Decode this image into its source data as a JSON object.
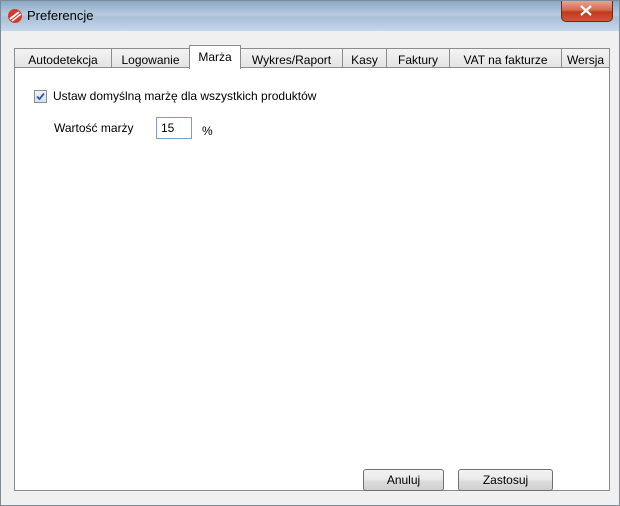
{
  "window": {
    "title": "Preferencje"
  },
  "tabs": [
    {
      "label": "Autodetekcja",
      "active": false
    },
    {
      "label": "Logowanie",
      "active": false
    },
    {
      "label": "Marża",
      "active": true
    },
    {
      "label": "Wykres/Raport",
      "active": false
    },
    {
      "label": "Kasy",
      "active": false
    },
    {
      "label": "Faktury",
      "active": false
    },
    {
      "label": "VAT na fakturze",
      "active": false
    },
    {
      "label": "Wersja",
      "active": false
    }
  ],
  "margin_tab": {
    "default_margin_checkbox": {
      "label": "Ustaw domyślną marżę dla wszystkich produktów",
      "checked": true
    },
    "margin_value": {
      "label": "Wartość marży",
      "value": "15",
      "unit": "%"
    }
  },
  "buttons": {
    "cancel": "Anuluj",
    "apply": "Zastosuj"
  },
  "colors": {
    "title_gradient": "#b7cce0",
    "close_button": "#c0391b",
    "accent_check": "#2c5aa0"
  }
}
